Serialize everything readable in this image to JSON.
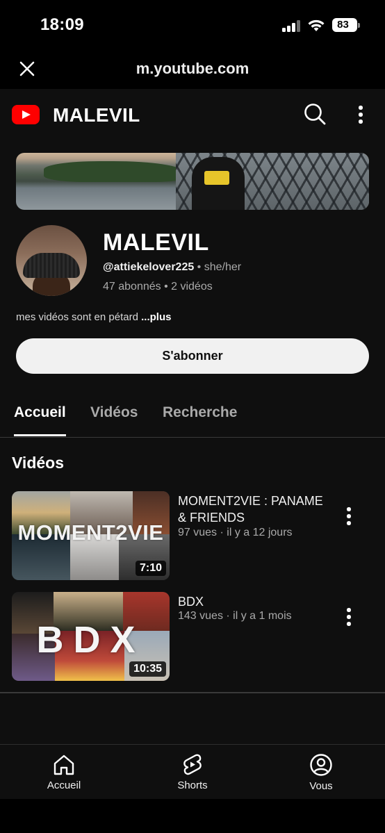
{
  "status_bar": {
    "time": "18:09",
    "battery": "83"
  },
  "browser": {
    "url": "m.youtube.com"
  },
  "header": {
    "title": "MALEVIL"
  },
  "channel": {
    "name": "MALEVIL",
    "handle": "@attiekelover225",
    "pronouns": " • she/her",
    "stats": "47 abonnés • 2 vidéos",
    "description": "mes vidéos sont en pétard ",
    "more_label": "...plus",
    "subscribe_label": "S'abonner"
  },
  "tabs": [
    {
      "label": "Accueil",
      "active": true
    },
    {
      "label": "Vidéos",
      "active": false
    },
    {
      "label": "Recherche",
      "active": false
    }
  ],
  "section": {
    "title": "Vidéos"
  },
  "videos": [
    {
      "title": "MOMENT2VIE : PANAME & FRIENDS",
      "meta": "97 vues · il y a 12 jours",
      "duration": "7:10",
      "thumb_text": "MOMENT2VIE"
    },
    {
      "title": "BDX",
      "meta": "143 vues · il y a 1 mois",
      "duration": "10:35",
      "thumb_text": "BDX"
    }
  ],
  "bottom_nav": [
    {
      "label": "Accueil",
      "icon": "home-icon"
    },
    {
      "label": "Shorts",
      "icon": "shorts-icon"
    },
    {
      "label": "Vous",
      "icon": "account-icon"
    }
  ],
  "colors": {
    "youtube_red": "#ff0000",
    "background": "#0f0f0f",
    "subscribe_bg": "#f1f1f1"
  }
}
